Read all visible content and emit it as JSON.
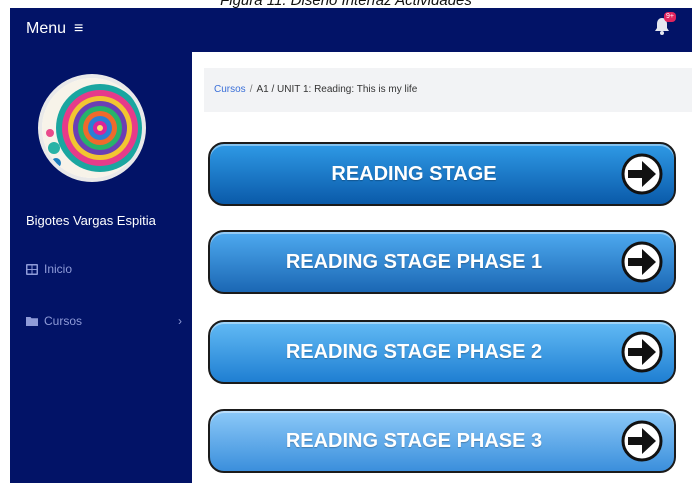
{
  "caption": "Figura 11. Diseño Interfaz Actividades",
  "header": {
    "menu_label": "Menu",
    "menu_icon": "hamburger-icon",
    "notification_badge": "9+",
    "notification_icon": "bell-icon"
  },
  "sidebar": {
    "user_name": "Bigotes Vargas Espitia",
    "items": [
      {
        "label": "Inicio",
        "icon": "grid-icon"
      },
      {
        "label": "Cursos",
        "icon": "folder-icon"
      }
    ]
  },
  "breadcrumb": {
    "root": "Cursos",
    "path": "A1 / UNIT 1: Reading: This is my life"
  },
  "buttons": [
    {
      "label": "READING STAGE"
    },
    {
      "label": "READING STAGE PHASE 1"
    },
    {
      "label": "READING STAGE PHASE 2"
    },
    {
      "label": "READING STAGE PHASE 3"
    }
  ],
  "colors": {
    "navbar": "#021367",
    "accent": "#3a6fd8",
    "badge": "#e0245e"
  }
}
